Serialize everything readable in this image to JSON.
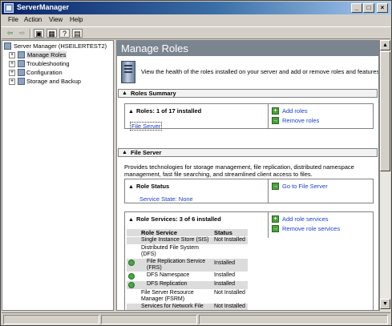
{
  "window": {
    "title": "ServerManager"
  },
  "menu": {
    "items": [
      "File",
      "Action",
      "View",
      "Help"
    ]
  },
  "tree": {
    "items": [
      {
        "label": "Server Manager (HSEILERTEST2)",
        "level": 0
      },
      {
        "label": "Manage Roles",
        "level": 1,
        "selected": true
      },
      {
        "label": "Troubleshooting",
        "level": 1
      },
      {
        "label": "Configuration",
        "level": 1
      },
      {
        "label": "Storage and Backup",
        "level": 1
      }
    ]
  },
  "pane": {
    "title": "Manage Roles",
    "description": "View the health of the roles installed on your server and add or remove roles and features."
  },
  "roles_summary": {
    "header": "Roles Summary",
    "roles_title": "Roles: 1 of 17 installed",
    "installed_role": "File Server",
    "actions": [
      "Add roles",
      "Remove roles"
    ]
  },
  "file_server": {
    "header": "File Server",
    "description": "Provides technologies for storage management, file replication, distributed namespace management, fast file searching, and streamlined client access to files.",
    "role_status": {
      "title": "Role Status",
      "state": "Service State: None",
      "action": "Go to File Server"
    },
    "role_services": {
      "title": "Role Services: 3 of 6 installed",
      "actions": [
        "Add role services",
        "Remove role services"
      ],
      "columns": [
        "Role Service",
        "Status"
      ],
      "rows": [
        {
          "name": "Single Instance Store (SIS)",
          "status": "Not Installed",
          "icon": false
        },
        {
          "name": "Distributed File System (DFS)",
          "status": "",
          "icon": false
        },
        {
          "name": "File Replication Service (FRS)",
          "status": "Installed",
          "icon": true
        },
        {
          "name": "DFS Namespace",
          "status": "Installed",
          "icon": true
        },
        {
          "name": "DFS Replication",
          "status": "Installed",
          "icon": true
        },
        {
          "name": "File Server Resource Manager (FSRM)",
          "status": "Not Installed",
          "icon": false
        },
        {
          "name": "Services for Network File",
          "status": "Not Installed",
          "icon": false
        }
      ]
    }
  },
  "colors": {
    "title_start": "#0a246a",
    "title_end": "#a6caf0",
    "pane_header": "#7b8590",
    "link": "#1a3fd1",
    "success": "#46a843"
  }
}
